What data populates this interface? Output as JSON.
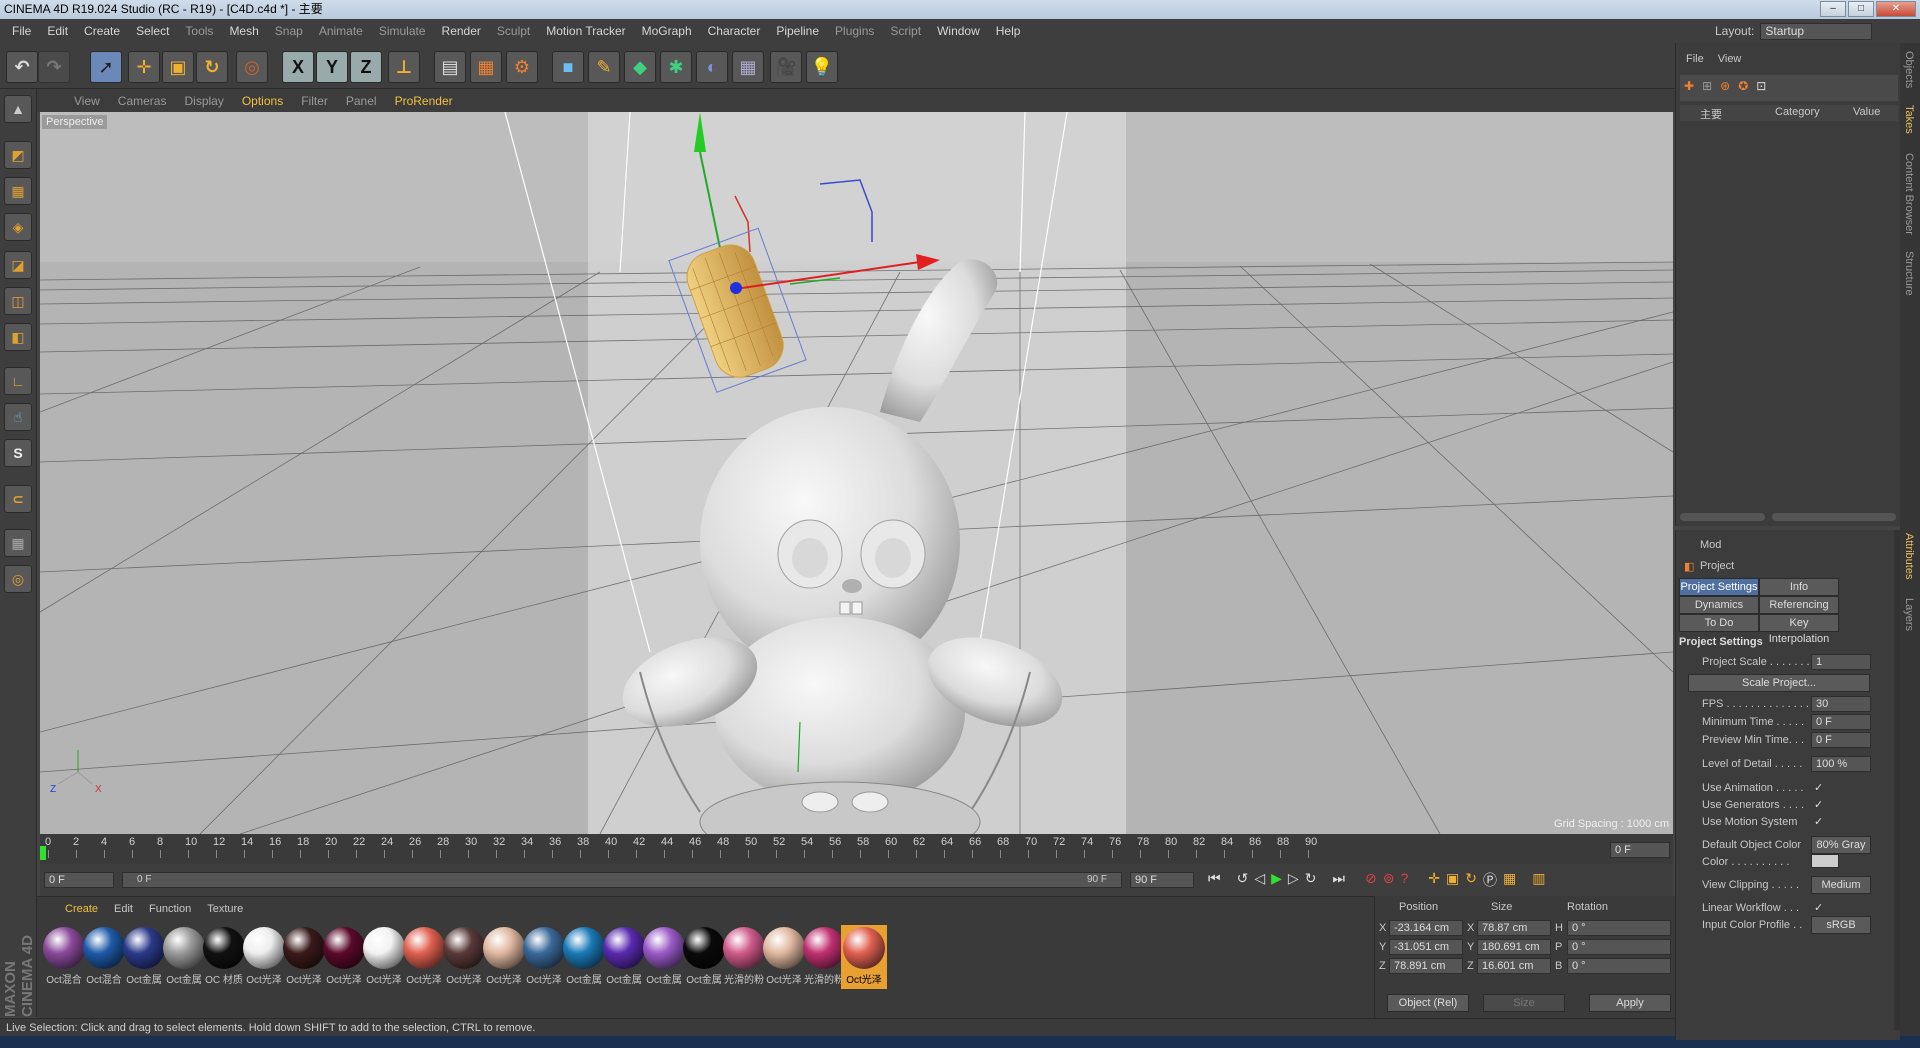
{
  "window": {
    "title": "CINEMA 4D R19.024 Studio (RC - R19) - [C4D.c4d *] - 主要"
  },
  "menu": [
    "File",
    "Edit",
    "Create",
    "Select",
    "Tools",
    "Mesh",
    "Snap",
    "Animate",
    "Simulate",
    "Render",
    "Sculpt",
    "Motion Tracker",
    "MoGraph",
    "Character",
    "Pipeline",
    "Plugins",
    "Script",
    "Window",
    "Help"
  ],
  "layout": {
    "label": "Layout:",
    "value": "Startup"
  },
  "toolbar": {
    "axis": [
      "X",
      "Y",
      "Z"
    ]
  },
  "viewport": {
    "menu": [
      "View",
      "Cameras",
      "Display",
      "Options",
      "Filter",
      "Panel",
      "ProRender"
    ],
    "label": "Perspective",
    "grid_spacing": "Grid Spacing : 1000 cm"
  },
  "timeline": {
    "ticks": [
      "0",
      "2",
      "4",
      "6",
      "8",
      "10",
      "12",
      "14",
      "16",
      "18",
      "20",
      "22",
      "24",
      "26",
      "28",
      "30",
      "32",
      "34",
      "36",
      "38",
      "40",
      "42",
      "44",
      "46",
      "48",
      "50",
      "52",
      "54",
      "56",
      "58",
      "60",
      "62",
      "64",
      "66",
      "68",
      "70",
      "72",
      "74",
      "76",
      "78",
      "80",
      "82",
      "84",
      "86",
      "88",
      "90"
    ],
    "current_frame": "0 F",
    "start": "0 F",
    "range_left": "0 F",
    "range_right": "90 F",
    "end": "90 F"
  },
  "materials": {
    "tabs": [
      "Create",
      "Edit",
      "Function",
      "Texture"
    ],
    "items": [
      {
        "label": "Oct混合",
        "color": "#8a4a9a"
      },
      {
        "label": "Oct混合",
        "color": "#1e5aa8"
      },
      {
        "label": "Oct金属",
        "color": "#2a3a8a"
      },
      {
        "label": "Oct金属",
        "color": "#9a9a9a"
      },
      {
        "label": "OC 材质",
        "color": "#111111"
      },
      {
        "label": "Oct光泽",
        "color": "#eeeeee"
      },
      {
        "label": "Oct光泽",
        "color": "#3a1a1a"
      },
      {
        "label": "Oct光泽",
        "color": "#5a0a2a"
      },
      {
        "label": "Oct光泽",
        "color": "#f2f2f2"
      },
      {
        "label": "Oct光泽",
        "color": "#e06050"
      },
      {
        "label": "Oct光泽",
        "color": "#5a3a3a"
      },
      {
        "label": "Oct光泽",
        "color": "#e0b8a0"
      },
      {
        "label": "Oct光泽",
        "color": "#3a6a9a"
      },
      {
        "label": "Oct金属",
        "color": "#1a7ab8"
      },
      {
        "label": "Oct金属",
        "color": "#5a2ab0"
      },
      {
        "label": "Oct金属",
        "color": "#9a5ac8"
      },
      {
        "label": "Oct金属",
        "color": "#0a0a0a"
      },
      {
        "label": "光滑的粉",
        "color": "#d05a8a"
      },
      {
        "label": "Oct光泽",
        "color": "#e0b8a0"
      },
      {
        "label": "光滑的粉",
        "color": "#c03070"
      },
      {
        "label": "Oct光泽",
        "color": "#e06050"
      }
    ]
  },
  "coords": {
    "headers": [
      "Position",
      "Size",
      "Rotation"
    ],
    "rows": [
      {
        "axis": "X",
        "pos": "-23.164 cm",
        "saxis": "X",
        "size": "78.87 cm",
        "raxis": "H",
        "rot": "0 °"
      },
      {
        "axis": "Y",
        "pos": "-31.051 cm",
        "saxis": "Y",
        "size": "180.691 cm",
        "raxis": "P",
        "rot": "0 °"
      },
      {
        "axis": "Z",
        "pos": "78.891 cm",
        "saxis": "Z",
        "size": "16.601 cm",
        "raxis": "B",
        "rot": "0 °"
      }
    ],
    "mode": "Object (Rel)",
    "size_mode": "Size",
    "apply": "Apply"
  },
  "status": "Live Selection: Click and drag to select elements. Hold down SHIFT to add to the selection, CTRL to remove.",
  "objects": {
    "menu": [
      "File",
      "View"
    ],
    "root": "主要",
    "col_category": "Category",
    "col_value": "Value"
  },
  "attributes": {
    "mode": "Mod",
    "object": "Project",
    "tabs": [
      "Project Settings",
      "Info",
      "Dynamics",
      "Referencing",
      "To Do",
      "Key Interpolation"
    ],
    "section": "Project Settings",
    "rows": [
      {
        "label": "Project Scale . . . . . . .",
        "value": "1"
      },
      {
        "label": "FPS . . . . . . . . . . . . . . .",
        "value": "30"
      },
      {
        "label": "Minimum Time . . . . .",
        "value": "0 F"
      },
      {
        "label": "Preview Min Time. . .",
        "value": "0 F"
      },
      {
        "label": "Level of Detail . . . . .",
        "value": "100 %"
      }
    ],
    "scale_button": "Scale Project...",
    "checks": [
      {
        "label": "Use Animation . . . . .",
        "value": "✓"
      },
      {
        "label": "Use Generators . . . .",
        "value": "✓"
      },
      {
        "label": "Use Motion System",
        "value": "✓"
      }
    ],
    "default_color_label": "Default Object Color",
    "default_color_value": "80% Gray",
    "color_label": "Color . . . . . . . . . .",
    "view_clipping_label": "View Clipping . . . . .",
    "view_clipping_value": "Medium",
    "linear_workflow_label": "Linear Workflow . . .",
    "linear_workflow_value": "✓",
    "input_profile_label": "Input Color Profile . .",
    "input_profile_value": "sRGB"
  },
  "sidetabs": [
    "Objects",
    "Takes",
    "Content Browser",
    "Structure",
    "Attributes",
    "Layers"
  ],
  "brand": "MAXON CINEMA 4D"
}
